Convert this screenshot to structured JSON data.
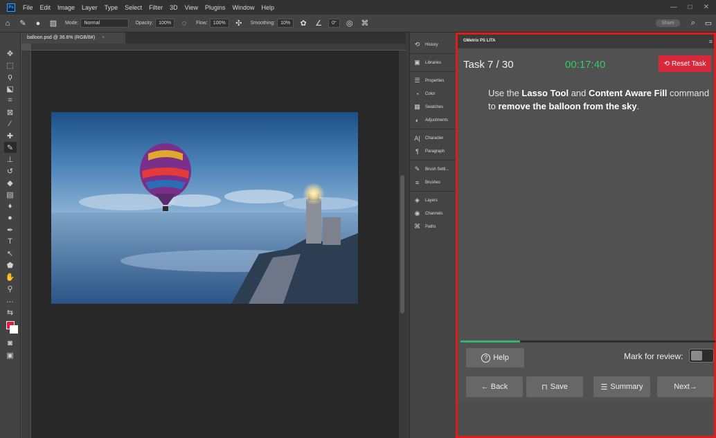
{
  "app": {
    "logo_text": "Ps"
  },
  "menubar": {
    "items": [
      "File",
      "Edit",
      "Image",
      "Layer",
      "Type",
      "Select",
      "Filter",
      "3D",
      "View",
      "Plugins",
      "Window",
      "Help"
    ],
    "window_controls": [
      "—",
      "□",
      "✕"
    ]
  },
  "options": {
    "mode_label": "Mode:",
    "mode_value": "Normal",
    "opacity_label": "Opacity:",
    "opacity_value": "100%",
    "flow_label": "Flow:",
    "flow_value": "100%",
    "smoothing_label": "Smoothing:",
    "smoothing_value": "10%",
    "angle_value": "0°",
    "share_label": "Share"
  },
  "document": {
    "tab_title": "balloon.psd @ 36.6% (RGB/8#)",
    "tab_close": "×"
  },
  "dock": {
    "items": [
      {
        "icon": "history-icon",
        "glyph": "⟲",
        "label": "History"
      },
      {
        "icon": "libraries-icon",
        "glyph": "▣",
        "label": "Libraries"
      },
      {
        "icon": "properties-icon",
        "glyph": "☰",
        "label": "Properties"
      },
      {
        "icon": "color-icon",
        "glyph": "◔",
        "label": "Color"
      },
      {
        "icon": "swatches-icon",
        "glyph": "▦",
        "label": "Swatches"
      },
      {
        "icon": "adjustments-icon",
        "glyph": "◐",
        "label": "Adjustments"
      },
      {
        "icon": "character-icon",
        "glyph": "A|",
        "label": "Character"
      },
      {
        "icon": "paragraph-icon",
        "glyph": "¶",
        "label": "Paragraph"
      },
      {
        "icon": "brush-settings-icon",
        "glyph": "✎",
        "label": "Brush Setti..."
      },
      {
        "icon": "brushes-icon",
        "glyph": "≡",
        "label": "Brushes"
      },
      {
        "icon": "layers-icon",
        "glyph": "◈",
        "label": "Layers"
      },
      {
        "icon": "channels-icon",
        "glyph": "◉",
        "label": "Channels"
      },
      {
        "icon": "paths-icon",
        "glyph": "⌘",
        "label": "Paths"
      }
    ]
  },
  "gmetrix": {
    "header": "GMetrix PS LITA",
    "menu_glyph": "≡",
    "task": "Task 7 / 30",
    "timer": "00:17:40",
    "reset_label": "Reset Task",
    "instruction": {
      "p1": "Use the ",
      "b1": "Lasso Tool",
      "p2": " and ",
      "b2": "Content Aware Fill",
      "p3": " command to ",
      "b3": "remove the balloon from the sky",
      "p4": "."
    },
    "progress_fraction": 0.233,
    "help_label": "Help",
    "help_glyph": "?",
    "review_label": "Mark for review:",
    "review_checked": false,
    "back_label": "← Back",
    "save_label": "Save",
    "summary_label": "Summary",
    "next_label": "Next→"
  },
  "colors": {
    "accent_red": "#e31a1a",
    "timer_green": "#33cc66",
    "reset_red": "#d9283c",
    "foreground_color": "#e8193c",
    "background_color": "#ffffff"
  }
}
